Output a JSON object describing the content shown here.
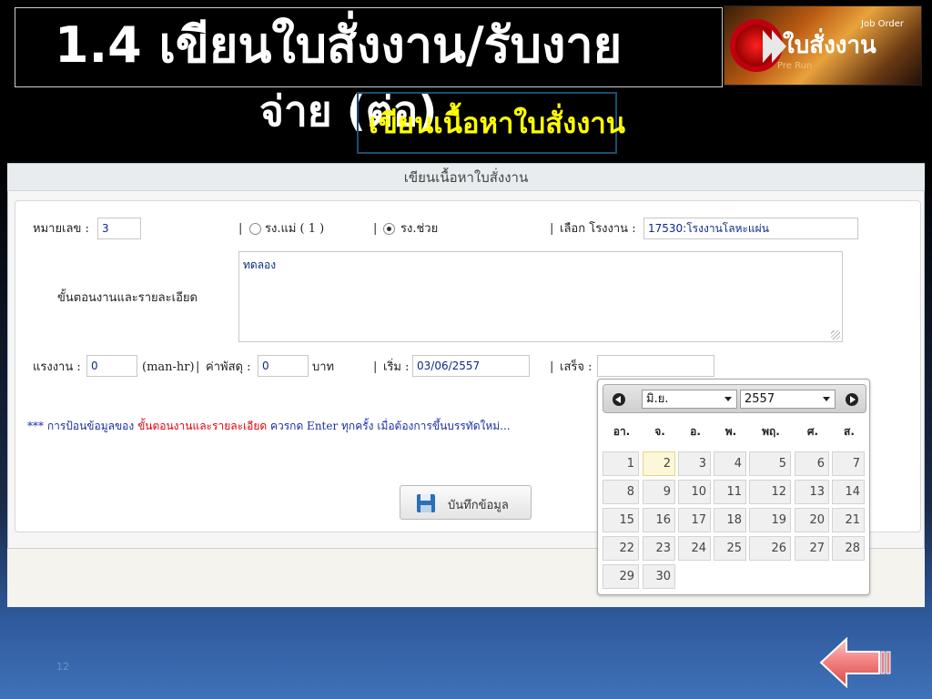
{
  "slide": {
    "title_line1": "1.4  เขียนใบสั่งงาน/รับงาย",
    "title_line2": "จ่าย (ต่อ)",
    "caption": "เขียนเนื้อหาใบสั่งงาน",
    "slide_number": "12"
  },
  "logo": {
    "main_text": "ใบสั่งงาน",
    "sub_text": "Job Order",
    "tagline": "Pre Run"
  },
  "form": {
    "header": "เขียนเนื้อหาใบสั่งงาน",
    "number_label": "หมายเลข :",
    "number_value": "3",
    "radio_main_label": "รง.แม่ ( 1 )",
    "radio_sub_label": "รง.ช่วย",
    "factory_label": "เลือก โรงงาน :",
    "factory_value": "17530:โรงงานโลหะแผ่น",
    "details_label": "ขั้นตอนงานและรายละเอียด",
    "details_value": "ทดลอง",
    "labor_label": "แรงงาน :",
    "labor_value": "0",
    "labor_unit": "(man-hr)",
    "material_label": "ค่าพัสดุ :",
    "material_value": "0",
    "material_unit": "บาท",
    "start_label": "เริ่ม :",
    "start_value": "03/06/2557",
    "finish_label": "เสร็จ :",
    "finish_value": "",
    "note_prefix": "*** การป้อนข้อมูลของ ",
    "note_highlight": "ขั้นตอนงานและรายละเอียด",
    "note_suffix": " ควรกด Enter ทุกครั้ง เมื่อต้องการขึ้นบรรทัดใหม่...",
    "save_label": "บันทึกข้อมูล"
  },
  "datepicker": {
    "month": "มิ.ย.",
    "year": "2557",
    "weekdays": [
      "อา.",
      "จ.",
      "อ.",
      "พ.",
      "พฤ.",
      "ศ.",
      "ส."
    ],
    "today": "2",
    "weeks": [
      [
        "1",
        "2",
        "3",
        "4",
        "5",
        "6",
        "7"
      ],
      [
        "8",
        "9",
        "10",
        "11",
        "12",
        "13",
        "14"
      ],
      [
        "15",
        "16",
        "17",
        "18",
        "19",
        "20",
        "21"
      ],
      [
        "22",
        "23",
        "24",
        "25",
        "26",
        "27",
        "28"
      ],
      [
        "29",
        "30",
        "",
        "",
        "",
        "",
        ""
      ]
    ]
  },
  "colors": {
    "caption": "#ffff00",
    "input_text": "#0d2a8a",
    "note_text": "#1a2fa8",
    "note_highlight": "#e0000a"
  }
}
